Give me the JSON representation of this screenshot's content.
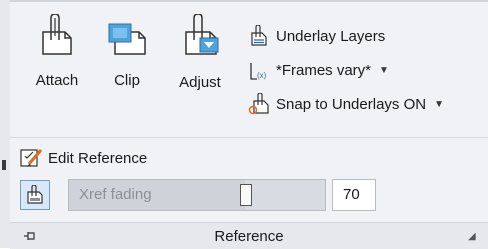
{
  "ribbon": {
    "panel_title": "Reference",
    "big_buttons": [
      {
        "label": "Attach",
        "icon": "attach-icon"
      },
      {
        "label": "Clip",
        "icon": "clip-icon"
      },
      {
        "label": "Adjust",
        "icon": "adjust-icon"
      }
    ],
    "small_buttons": [
      {
        "label": "Underlay Layers",
        "icon": "underlay-layers-icon"
      },
      {
        "label": "*Frames vary*",
        "icon": "frames-icon",
        "dropdown": true
      },
      {
        "label": "Snap to Underlays ON",
        "icon": "snap-icon",
        "dropdown": true
      }
    ],
    "edit_reference": {
      "label": "Edit Reference",
      "icon": "edit-reference-icon"
    },
    "xref_fading": {
      "placeholder": "Xref fading",
      "value": "70",
      "level": 0.7
    }
  }
}
